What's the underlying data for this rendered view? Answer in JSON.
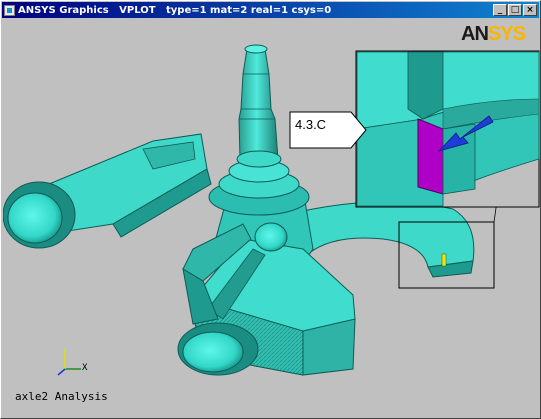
{
  "window": {
    "title": "ANSYS Graphics   VPLOT   type=1 mat=2 real=1 csys=0",
    "controls": {
      "minimize": "_",
      "maximize": "□",
      "close": "×"
    }
  },
  "graphics": {
    "logo_part1": "AN",
    "logo_part2": "SYS",
    "callout_label": "4.3.C",
    "axis_x_label": "X",
    "caption": "axle2 Analysis"
  },
  "colors": {
    "model_face": "#40e0d0",
    "model_dark": "#1a9a8e",
    "background": "#c0c0c0",
    "highlight_face": "#b000c8",
    "arrow": "#1e3cd8",
    "title_bar": "#000080"
  }
}
